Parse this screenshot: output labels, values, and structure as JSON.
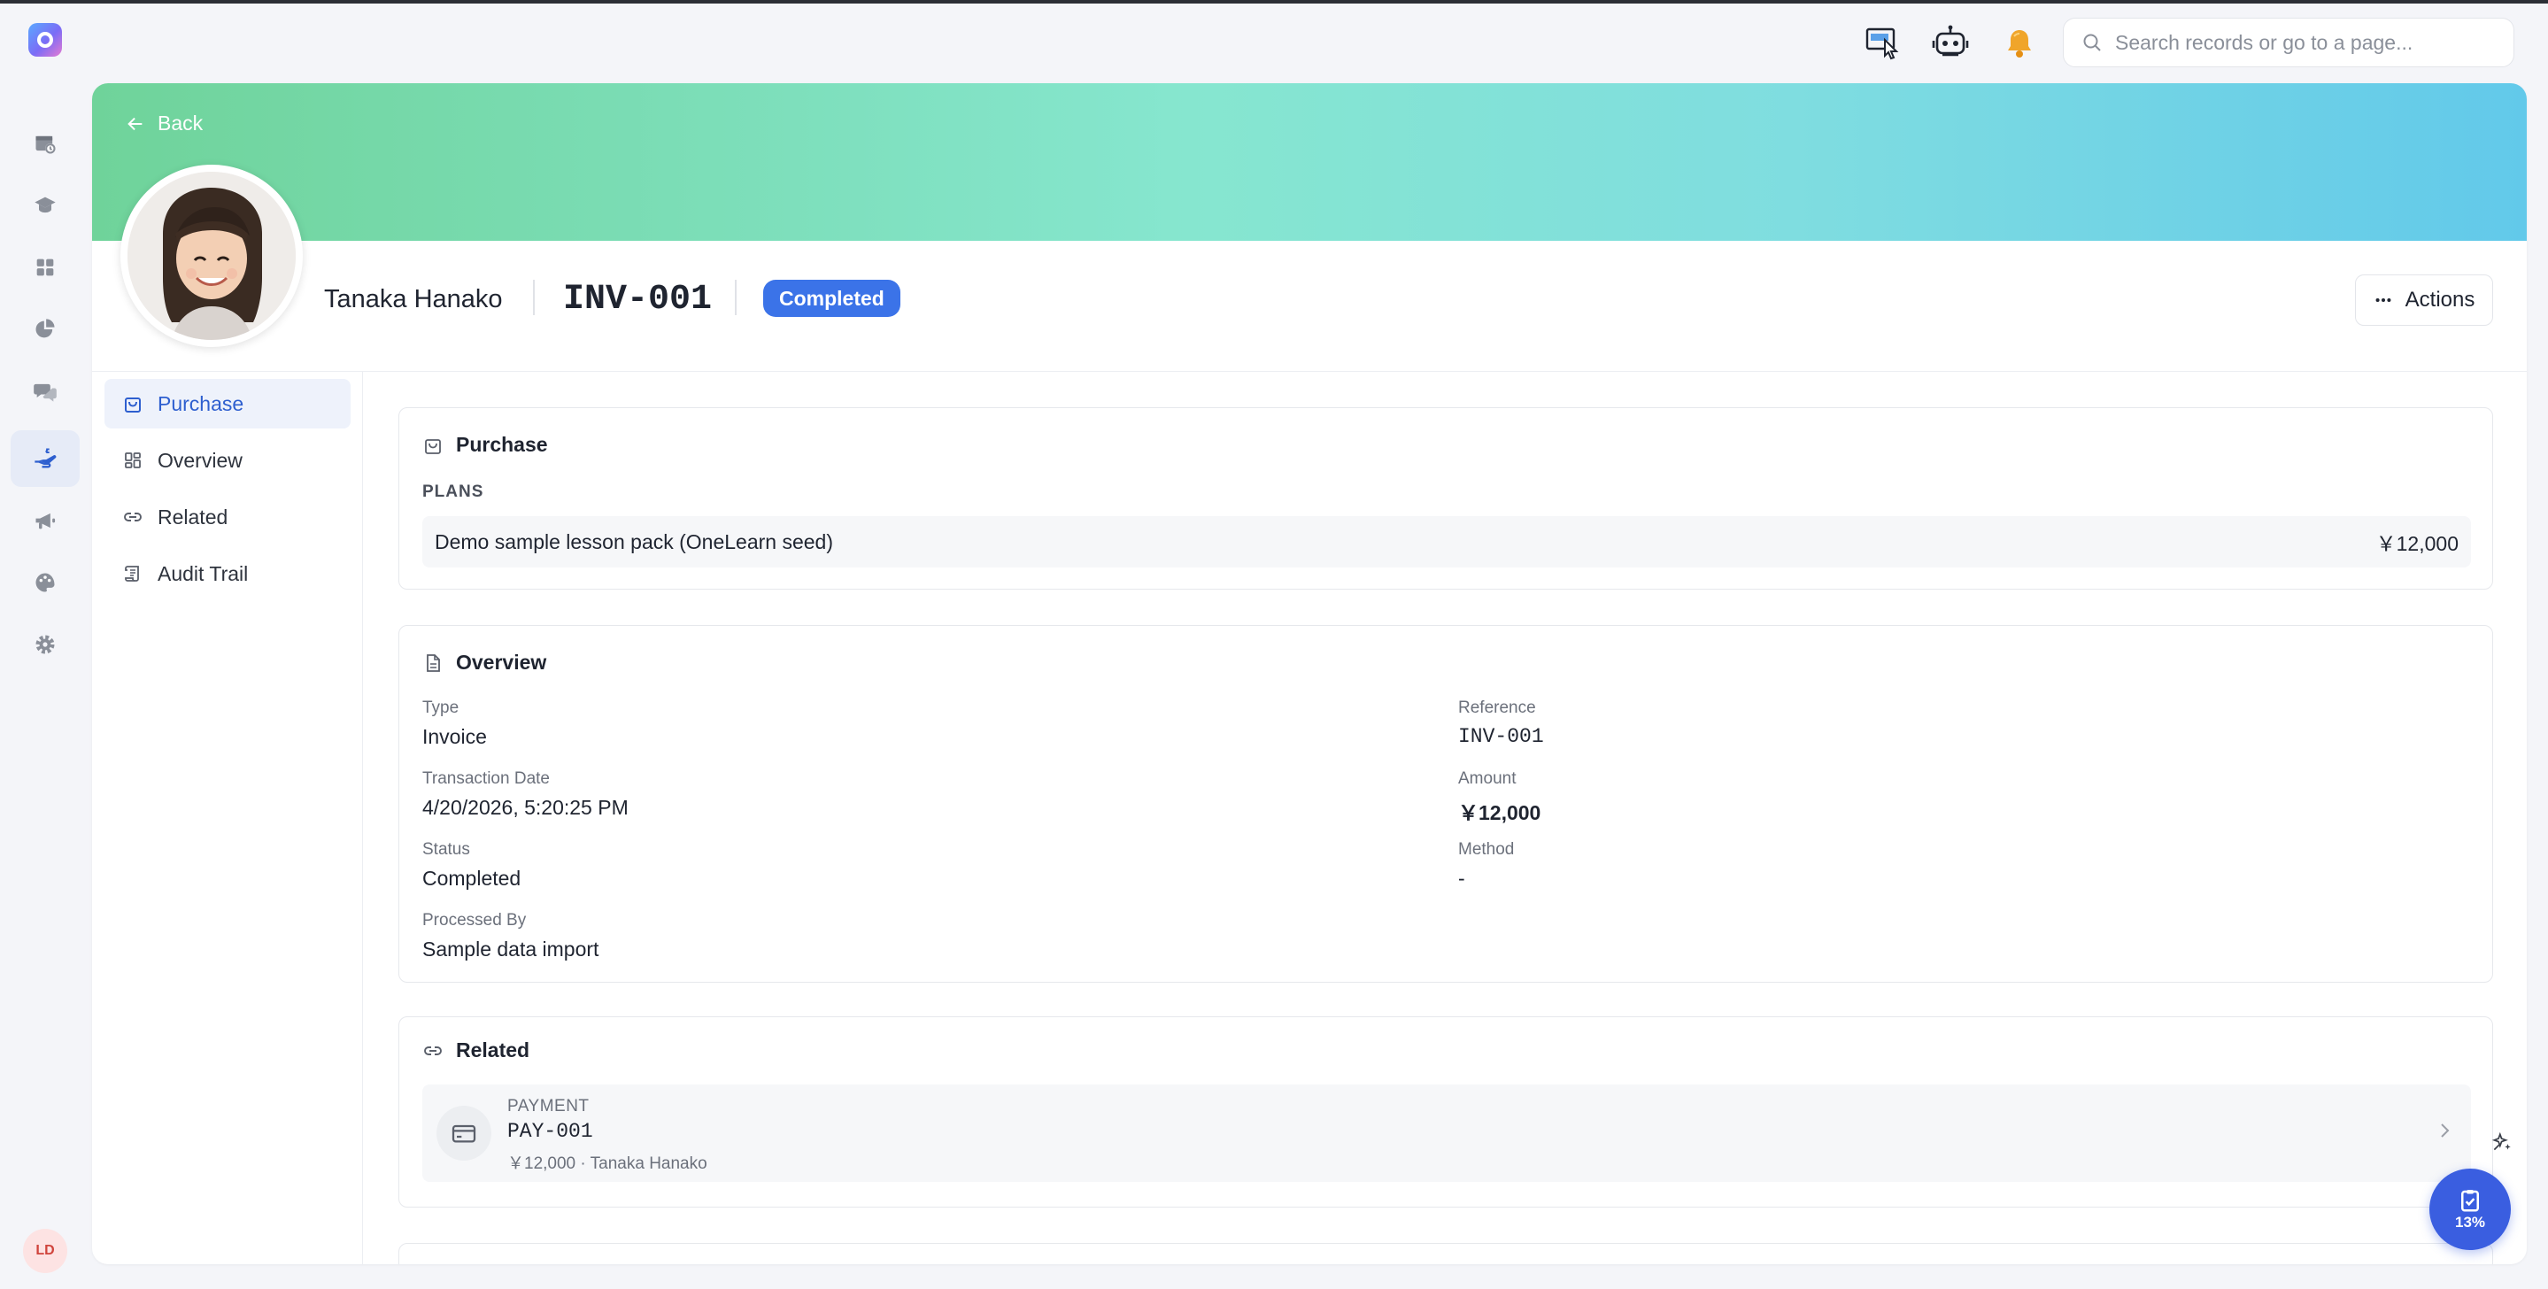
{
  "search": {
    "placeholder": "Search records or go to a page..."
  },
  "user": {
    "initials": "LD"
  },
  "header": {
    "back_label": "Back",
    "name": "Tanaka Hanako",
    "reference": "INV-001",
    "status": "Completed",
    "actions_label": "Actions"
  },
  "nav": {
    "items": [
      {
        "label": "Purchase",
        "icon": "bag-icon"
      },
      {
        "label": "Overview",
        "icon": "grid-icon"
      },
      {
        "label": "Related",
        "icon": "link-icon"
      },
      {
        "label": "Audit Trail",
        "icon": "scroll-icon"
      }
    ]
  },
  "purchase": {
    "title": "Purchase",
    "plans_label": "PLANS",
    "plan_name": "Demo sample lesson pack (OneLearn seed)",
    "plan_price": "￥12,000"
  },
  "overview": {
    "title": "Overview",
    "fields": {
      "type": {
        "label": "Type",
        "value": "Invoice"
      },
      "reference": {
        "label": "Reference",
        "value": "INV-001"
      },
      "transaction_date": {
        "label": "Transaction Date",
        "value": "4/20/2026, 5:20:25 PM"
      },
      "amount": {
        "label": "Amount",
        "value": "￥12,000"
      },
      "status": {
        "label": "Status",
        "value": "Completed"
      },
      "method": {
        "label": "Method",
        "value": "-"
      },
      "processed_by": {
        "label": "Processed By",
        "value": "Sample data import"
      }
    }
  },
  "related": {
    "title": "Related",
    "item": {
      "kind": "PAYMENT",
      "id": "PAY-001",
      "subtitle": "￥12,000 · Tanaka Hanako"
    }
  },
  "fab": {
    "progress": "13%"
  },
  "colors": {
    "accent": "#3b73e8",
    "fab": "#3a5ee0",
    "active_nav": "#2e5fcf"
  }
}
